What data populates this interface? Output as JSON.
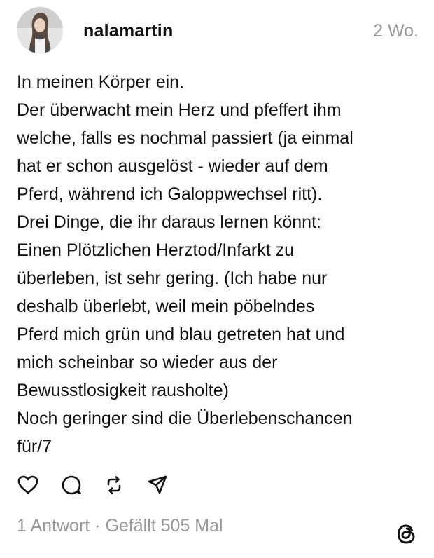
{
  "post": {
    "username": "nalamartin",
    "time": "2 Wo.",
    "avatar_icon": "user-avatar-photo",
    "lines": [
      "In meinen Körper ein.",
      "Der überwacht mein Herz und pfeffert ihm",
      "welche, falls es nochmal passiert (ja einmal",
      "hat er schon ausgelöst - wieder auf dem",
      "Pferd, während ich Galoppwechsel ritt).",
      "Drei Dinge, die ihr daraus lernen könnt:",
      "Einen Plötzlichen Herztod/Infarkt zu",
      "überleben, ist sehr gering. (Ich habe nur",
      "deshalb überlebt, weil mein pöbelndes",
      "Pferd mich grün und blau getreten hat und",
      "mich scheinbar so wieder aus der",
      "Bewusstlosigkeit rausholte)",
      "Noch geringer sind die Überlebenschancen",
      "für/7"
    ],
    "stats": "1 Antwort · Gefällt 505 Mal"
  },
  "actions": {
    "icons": [
      "heart-icon",
      "comment-icon",
      "repost-icon",
      "share-icon"
    ]
  },
  "branding": {
    "logo_icon": "threads-logo-icon"
  },
  "colors": {
    "text": "#111111",
    "muted": "#999999",
    "background": "#ffffff"
  }
}
